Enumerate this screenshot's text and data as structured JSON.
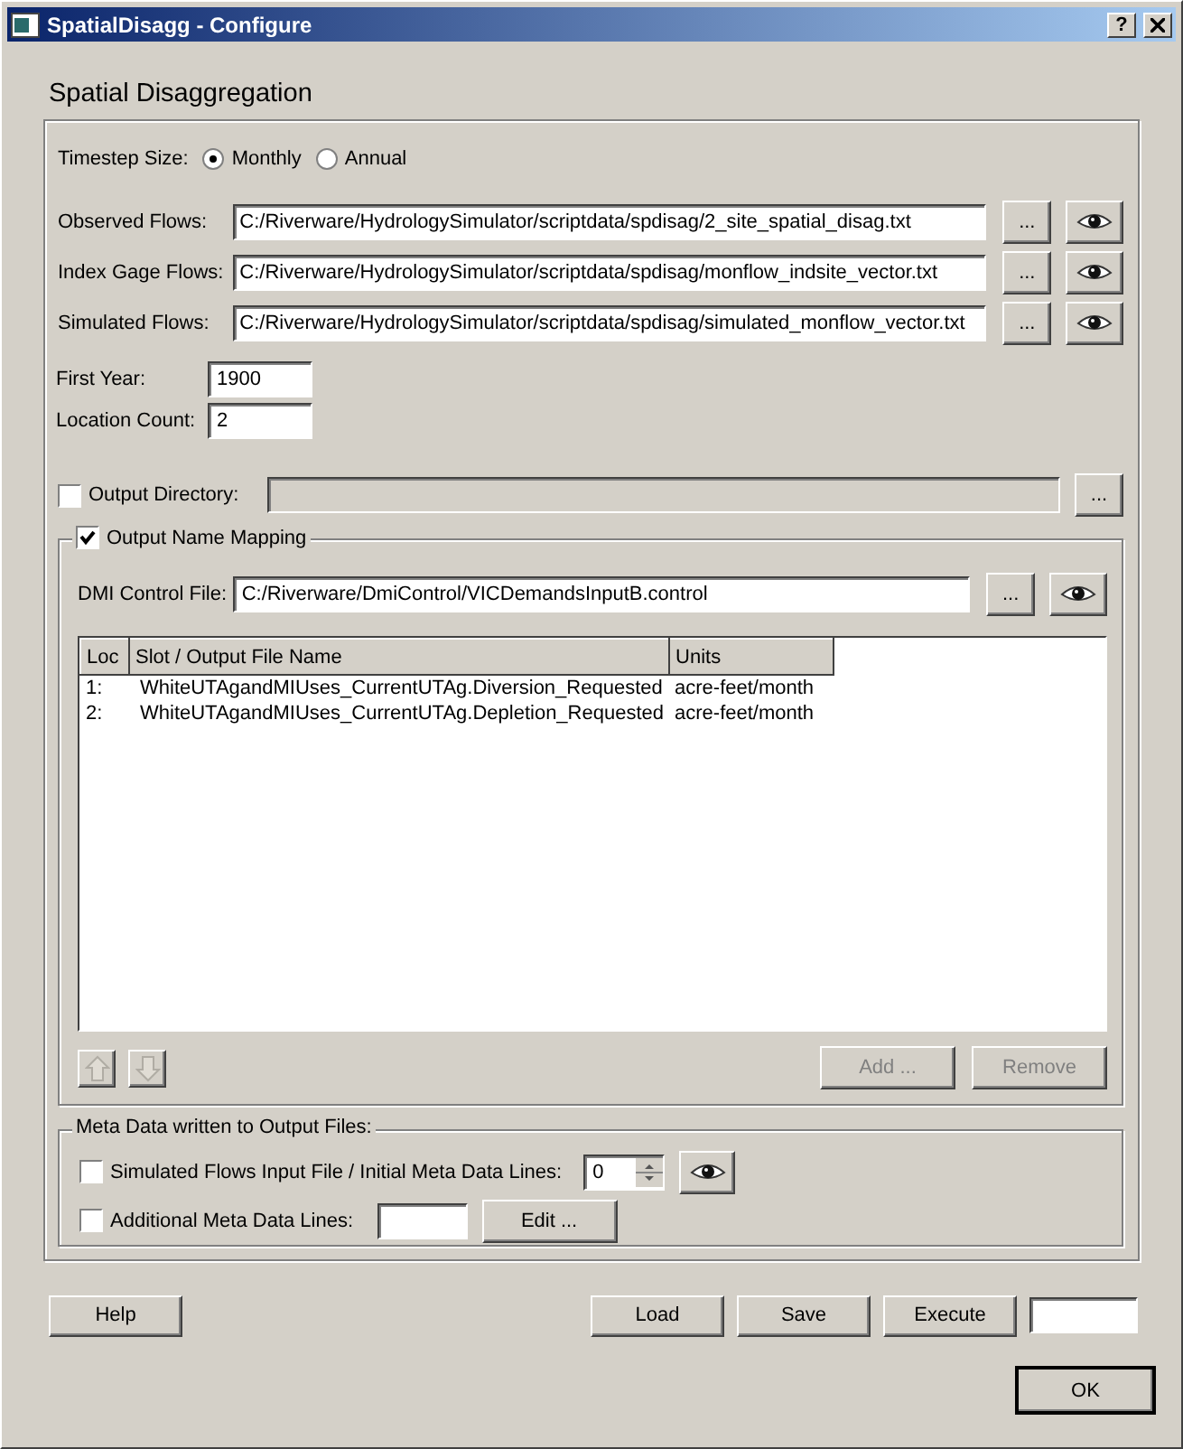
{
  "window": {
    "title": "SpatialDisagg - Configure",
    "help_button": "?"
  },
  "heading": "Spatial Disaggregation",
  "timestep": {
    "label": "Timestep Size:",
    "options": [
      {
        "label": "Monthly",
        "selected": true
      },
      {
        "label": "Annual",
        "selected": false
      }
    ]
  },
  "file_rows": [
    {
      "label": "Observed Flows:",
      "value": "C:/Riverware/HydrologySimulator/scriptdata/spdisag/2_site_spatial_disag.txt",
      "browse": "..."
    },
    {
      "label": "Index Gage Flows:",
      "value": "C:/Riverware/HydrologySimulator/scriptdata/spdisag/monflow_indsite_vector.txt",
      "browse": "..."
    },
    {
      "label": "Simulated Flows:",
      "value": "C:/Riverware/HydrologySimulator/scriptdata/spdisag/simulated_monflow_vector.txt",
      "browse": "..."
    }
  ],
  "first_year": {
    "label": "First Year:",
    "value": "1900"
  },
  "location_count": {
    "label": "Location Count:",
    "value": "2"
  },
  "output_directory": {
    "label": "Output Directory:",
    "checked": false,
    "browse": "..."
  },
  "mapping": {
    "label": "Output Name Mapping",
    "checked": true,
    "dmi": {
      "label": "DMI Control File:",
      "value": "C:/Riverware/DmiControl/VICDemandsInputB.control",
      "browse": "..."
    },
    "table": {
      "columns": [
        "Loc",
        "Slot / Output File Name",
        "Units"
      ],
      "rows": [
        {
          "cells": [
            "1:",
            "WhiteUTAgandMIUses_CurrentUTAg.Diversion_Requested",
            "acre-feet/month"
          ]
        },
        {
          "cells": [
            "2:",
            "WhiteUTAgandMIUses_CurrentUTAg.Depletion_Requested",
            "acre-feet/month"
          ]
        }
      ]
    },
    "move_buttons": [
      {
        "kind": "up",
        "disabled": true
      },
      {
        "kind": "down",
        "disabled": true
      }
    ],
    "buttons": [
      {
        "label": "Add ...",
        "disabled": true
      },
      {
        "label": "Remove",
        "disabled": true
      }
    ]
  },
  "meta": {
    "title": "Meta Data written to Output Files:",
    "rows": [
      {
        "kind": "spinner",
        "label": "Simulated Flows Input File / Initial Meta Data Lines:",
        "checked": false,
        "value": "0"
      },
      {
        "kind": "edit",
        "label": "Additional Meta Data Lines:",
        "checked": false,
        "button": "Edit ..."
      }
    ]
  },
  "footer": {
    "help": "Help",
    "buttons": [
      "Load",
      "Save",
      "Execute"
    ],
    "ok": "OK"
  }
}
